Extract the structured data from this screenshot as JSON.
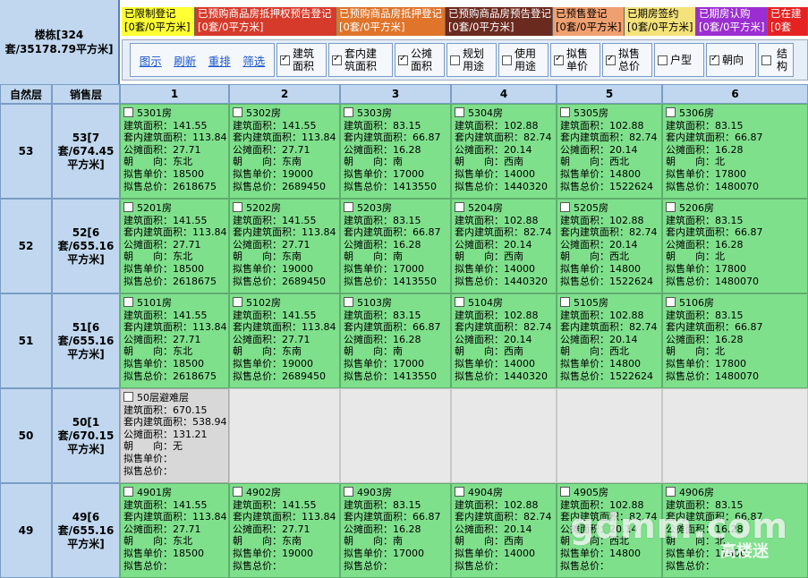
{
  "building": {
    "title": "楼栋[324套/35178.79平方米]"
  },
  "legend": [
    {
      "label": "已限制登记",
      "count": "[0套/0平方米]",
      "color": "#ffff33",
      "text_color": "#000000"
    },
    {
      "label": "已预购商品房抵押权预告登记",
      "count": "[0套/0平方米]",
      "color": "#d63a2a",
      "text_color": "#ffffff"
    },
    {
      "label": "已预购商品房抵押登记",
      "count": "[0套/0平方米]",
      "color": "#e0742a",
      "text_color": "#ffffff"
    },
    {
      "label": "已预购商品房预告登记",
      "count": "[0套/0平方米]",
      "color": "#6b2a1e",
      "text_color": "#ffffff"
    },
    {
      "label": "已预售登记",
      "count": "[0套/0平方米]",
      "color": "#f0a070",
      "text_color": "#000000"
    },
    {
      "label": "已期房签约",
      "count": "[0套/0平方米]",
      "color": "#f4e27a",
      "text_color": "#000000"
    },
    {
      "label": "已期房认购",
      "count": "[0套/0平方米]",
      "color": "#9b2ed0",
      "text_color": "#ffffff"
    },
    {
      "label": "已在建",
      "count": "[0套",
      "color": "#e52222",
      "text_color": "#ffffff"
    }
  ],
  "toolbar": {
    "links": [
      "图示",
      "刷新",
      "重排",
      "筛选"
    ],
    "checks": [
      {
        "label": "建筑\n面积",
        "checked": true
      },
      {
        "label": "套内建\n筑面积",
        "checked": true
      },
      {
        "label": "公摊\n面积",
        "checked": true
      },
      {
        "label": "规划\n用途",
        "checked": false
      },
      {
        "label": "使用\n用途",
        "checked": false
      },
      {
        "label": "拟售\n单价",
        "checked": true
      },
      {
        "label": "拟售\n总价",
        "checked": true
      },
      {
        "label": "户型",
        "checked": false
      },
      {
        "label": "朝向",
        "checked": true
      },
      {
        "label": "结构",
        "checked": false
      }
    ]
  },
  "headers": {
    "natural_floor": "自然层",
    "sales_floor": "销售层",
    "columns": [
      "1",
      "2",
      "3",
      "4",
      "5",
      "6"
    ]
  },
  "field_labels": {
    "area": "建筑面积：",
    "inner": "套内建筑面积：",
    "shared": "公摊面积：",
    "orient": "朝　　向：",
    "price": "拟售单价：",
    "total": "拟售总价："
  },
  "floors": [
    {
      "natural": "53",
      "sales": "53[7套/674.45平方米]",
      "units": [
        {
          "name": "5301房",
          "area": "141.55",
          "inner": "113.84",
          "shared": "27.71",
          "orient": "东北",
          "price": "18500",
          "total": "2618675"
        },
        {
          "name": "5302房",
          "area": "141.55",
          "inner": "113.84",
          "shared": "27.71",
          "orient": "东南",
          "price": "19000",
          "total": "2689450"
        },
        {
          "name": "5303房",
          "area": "83.15",
          "inner": "66.87",
          "shared": "16.28",
          "orient": "南",
          "price": "17000",
          "total": "1413550"
        },
        {
          "name": "5304房",
          "area": "102.88",
          "inner": "82.74",
          "shared": "20.14",
          "orient": "西南",
          "price": "14000",
          "total": "1440320"
        },
        {
          "name": "5305房",
          "area": "102.88",
          "inner": "82.74",
          "shared": "20.14",
          "orient": "西北",
          "price": "14800",
          "total": "1522624"
        },
        {
          "name": "5306房",
          "area": "83.15",
          "inner": "66.87",
          "shared": "16.28",
          "orient": "北",
          "price": "17800",
          "total": "1480070"
        }
      ]
    },
    {
      "natural": "52",
      "sales": "52[6套/655.16平方米]",
      "units": [
        {
          "name": "5201房",
          "area": "141.55",
          "inner": "113.84",
          "shared": "27.71",
          "orient": "东北",
          "price": "18500",
          "total": "2618675"
        },
        {
          "name": "5202房",
          "area": "141.55",
          "inner": "113.84",
          "shared": "27.71",
          "orient": "东南",
          "price": "19000",
          "total": "2689450"
        },
        {
          "name": "5203房",
          "area": "83.15",
          "inner": "66.87",
          "shared": "16.28",
          "orient": "南",
          "price": "17000",
          "total": "1413550"
        },
        {
          "name": "5204房",
          "area": "102.88",
          "inner": "82.74",
          "shared": "20.14",
          "orient": "西南",
          "price": "14000",
          "total": "1440320"
        },
        {
          "name": "5205房",
          "area": "102.88",
          "inner": "82.74",
          "shared": "20.14",
          "orient": "西北",
          "price": "14800",
          "total": "1522624"
        },
        {
          "name": "5206房",
          "area": "83.15",
          "inner": "66.87",
          "shared": "16.28",
          "orient": "北",
          "price": "17800",
          "total": "1480070"
        }
      ]
    },
    {
      "natural": "51",
      "sales": "51[6套/655.16平方米]",
      "units": [
        {
          "name": "5101房",
          "area": "141.55",
          "inner": "113.84",
          "shared": "27.71",
          "orient": "东北",
          "price": "18500",
          "total": "2618675"
        },
        {
          "name": "5102房",
          "area": "141.55",
          "inner": "113.84",
          "shared": "27.71",
          "orient": "东南",
          "price": "19000",
          "total": "2689450"
        },
        {
          "name": "5103房",
          "area": "83.15",
          "inner": "66.87",
          "shared": "16.28",
          "orient": "南",
          "price": "17000",
          "total": "1413550"
        },
        {
          "name": "5104房",
          "area": "102.88",
          "inner": "82.74",
          "shared": "20.14",
          "orient": "西南",
          "price": "14000",
          "total": "1440320"
        },
        {
          "name": "5105房",
          "area": "102.88",
          "inner": "82.74",
          "shared": "20.14",
          "orient": "西北",
          "price": "14800",
          "total": "1522624"
        },
        {
          "name": "5106房",
          "area": "83.15",
          "inner": "66.87",
          "shared": "16.28",
          "orient": "北",
          "price": "17800",
          "total": "1480070"
        }
      ]
    },
    {
      "natural": "50",
      "sales": "50[1套/670.15平方米]",
      "units": [
        {
          "name": "50层避难层",
          "area": "670.15",
          "inner": "538.94",
          "shared": "131.21",
          "orient": "无",
          "price": "",
          "total": "",
          "gray": true
        }
      ]
    },
    {
      "natural": "49",
      "sales": "49[6套/655.16平方米]",
      "units": [
        {
          "name": "4901房",
          "area": "141.55",
          "inner": "113.84",
          "shared": "27.71",
          "orient": "东北",
          "price": "18500",
          "total": ""
        },
        {
          "name": "4902房",
          "area": "141.55",
          "inner": "113.84",
          "shared": "27.71",
          "orient": "东南",
          "price": "19000",
          "total": ""
        },
        {
          "name": "4903房",
          "area": "83.15",
          "inner": "66.87",
          "shared": "16.28",
          "orient": "南",
          "price": "17000",
          "total": ""
        },
        {
          "name": "4904房",
          "area": "102.88",
          "inner": "82.74",
          "shared": "20.14",
          "orient": "西南",
          "price": "14000",
          "total": ""
        },
        {
          "name": "4905房",
          "area": "102.88",
          "inner": "82.74",
          "shared": "20.14",
          "orient": "西北",
          "price": "14800",
          "total": ""
        },
        {
          "name": "4906房",
          "area": "83.15",
          "inner": "66.87",
          "shared": "16.28",
          "orient": "北",
          "price": "17800",
          "total": ""
        }
      ]
    }
  ],
  "watermark": {
    "main": "gdmm.com",
    "sub": "高楼迷"
  }
}
